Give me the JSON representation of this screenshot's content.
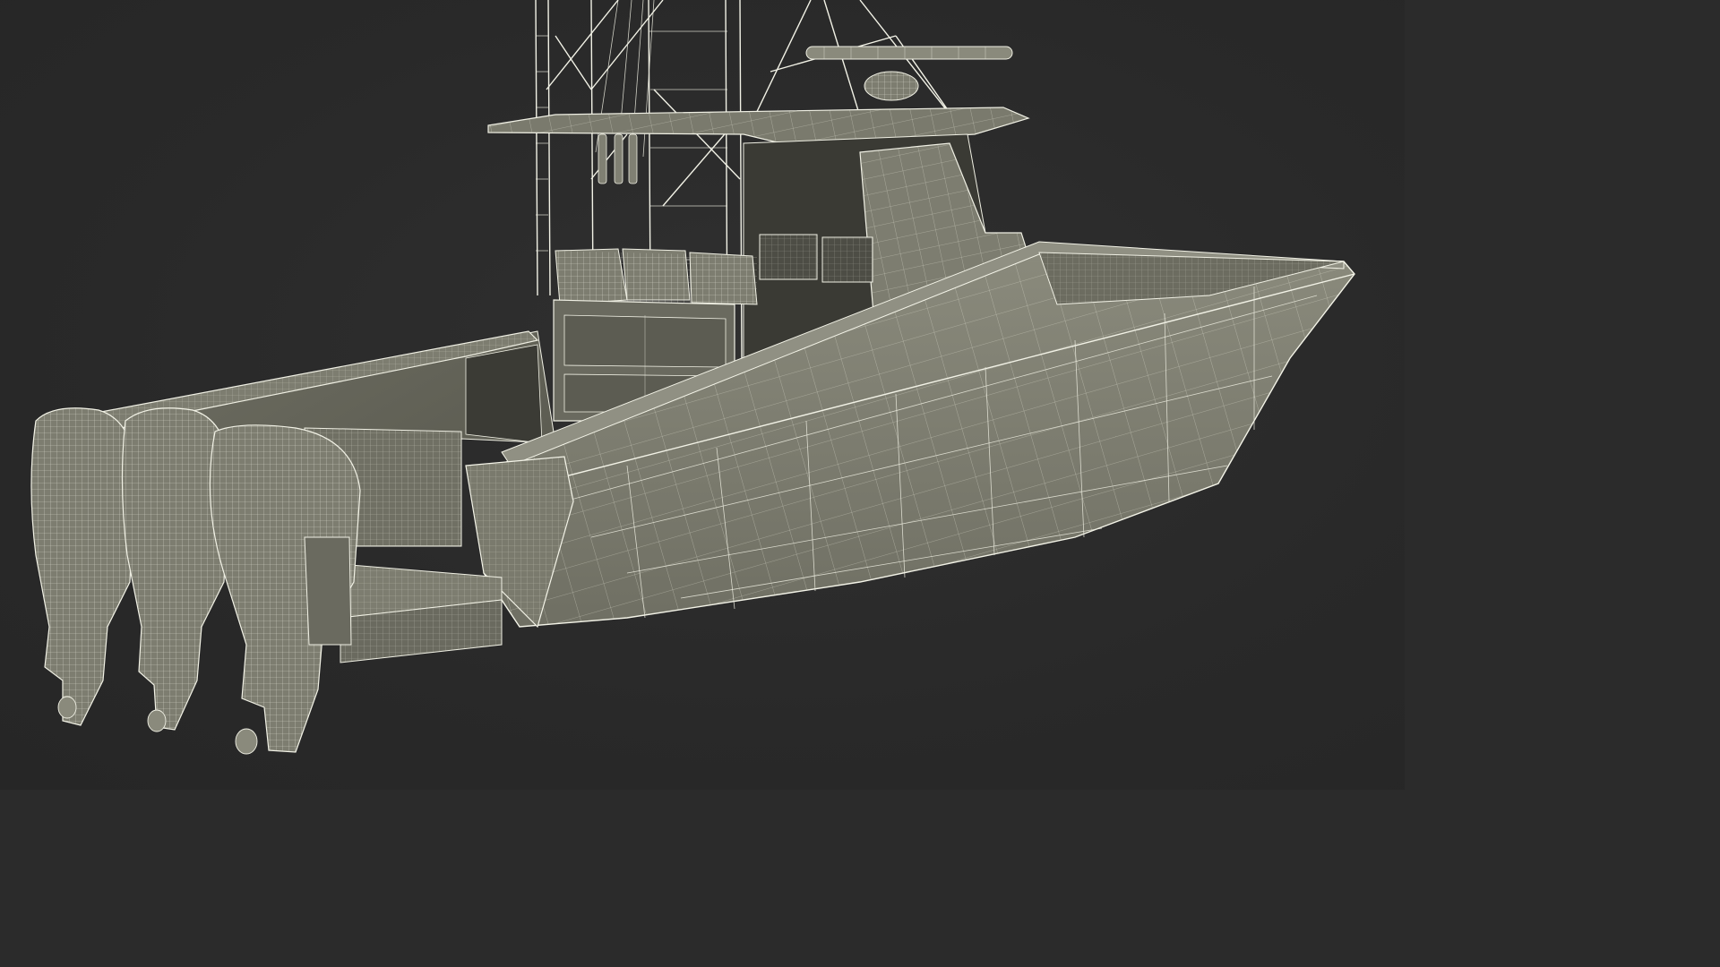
{
  "scene": {
    "subject": "center-console-boat-wireframe",
    "background_color": "#2b2b2b",
    "model_fill_color": "#7d7d70",
    "wire_color": "#ececdf"
  }
}
